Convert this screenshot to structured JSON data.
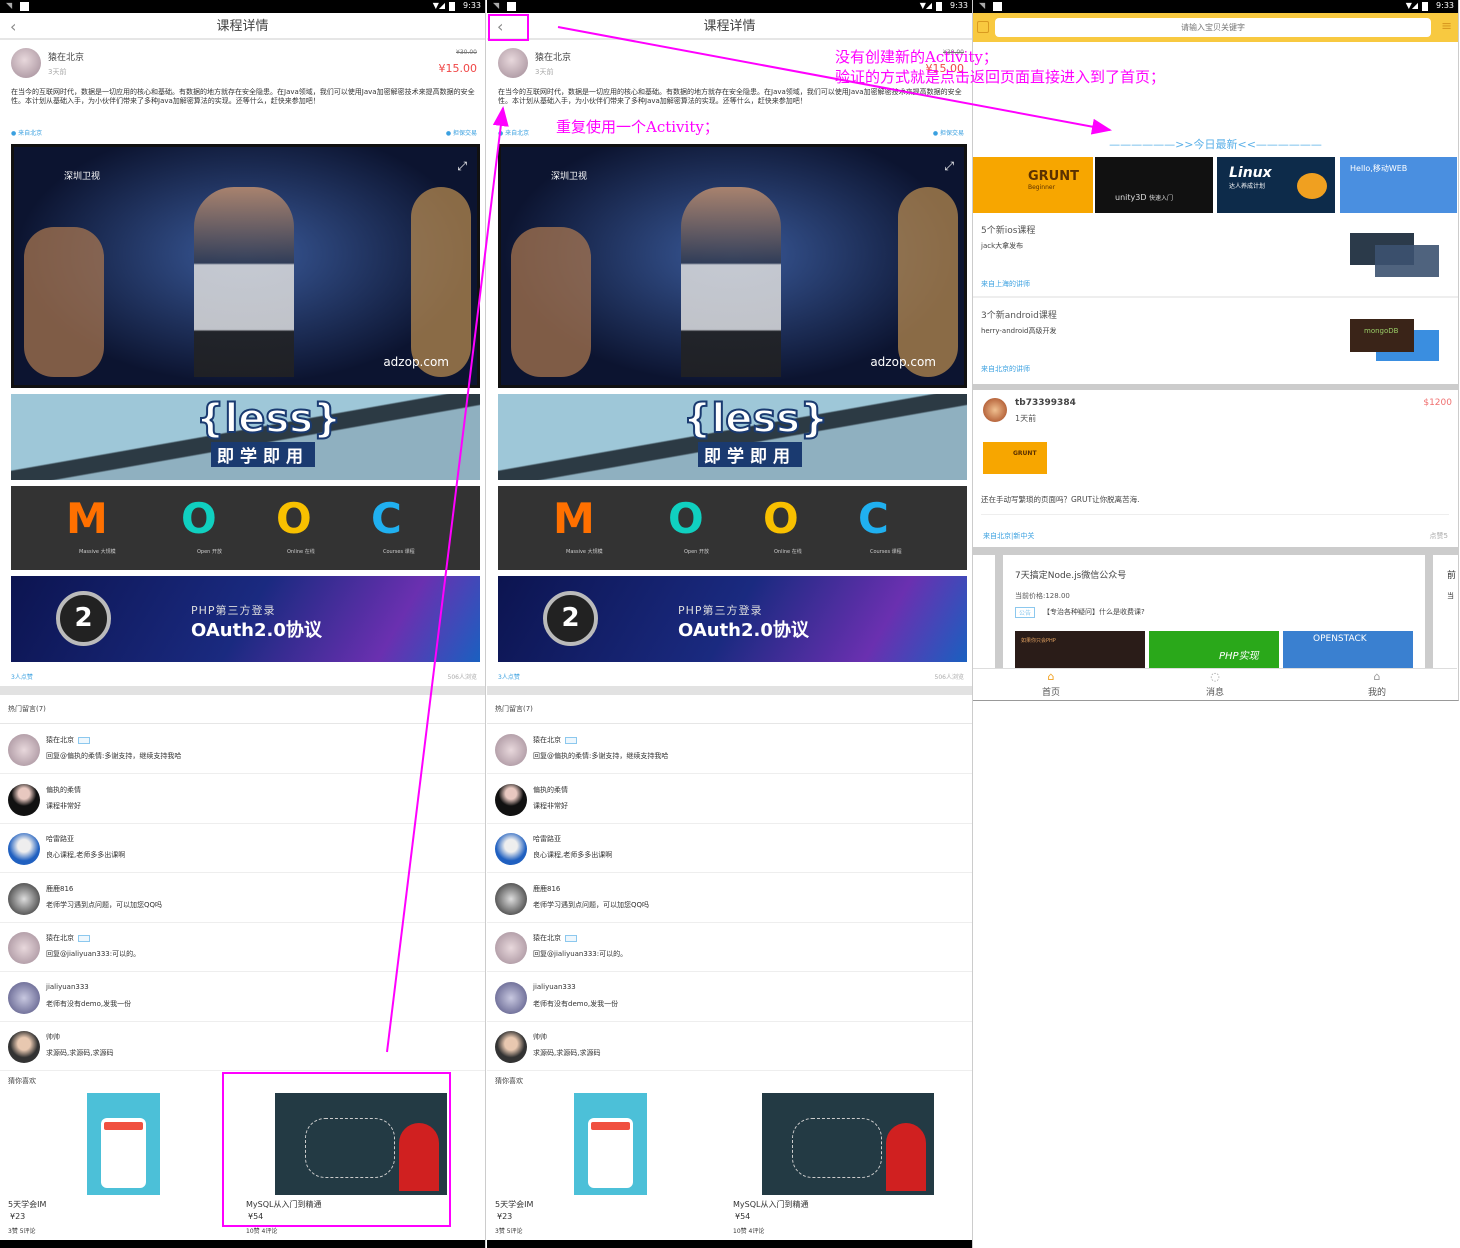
{
  "status_bar": {
    "time": "9:33"
  },
  "detail": {
    "title": "课程详情",
    "back_icon": "chevron-left-icon",
    "author": "猿在北京",
    "posted": "3天前",
    "original_price": "¥30.00",
    "price": "¥15.00",
    "description": "在当今的互联网时代，数据是一切应用的核心和基础。有数据的地方就存在安全隐患。在Java领域，我们可以使用Java加密解密技术来提高数据的安全性。本计划从基础入手，为小伙伴们带来了多种Java加解密算法的实现。还等什么，赶快来参加吧！",
    "location": "来自北京",
    "guarantee": "担保交易",
    "images": {
      "video_channel": "深圳卫视",
      "video_watermark": "adzop.com",
      "less_title": "{less}",
      "less_sub": "即学即用",
      "mooc_letters": [
        "M",
        "O",
        "O",
        "C"
      ],
      "mooc_words": [
        "Massive 大规模",
        "Open 开放",
        "Online 在线",
        "Courses 课程"
      ],
      "oauth_badge": "2",
      "oauth_sub": "PHP第三方登录",
      "oauth_title": "OAuth2.0协议"
    },
    "likes": "3人点赞",
    "views": "506人浏览",
    "comments_header": "热门留言(7)",
    "comments": [
      {
        "name": "猿在北京",
        "text": "回复@偏执的柔情:多谢支持，继续支持我哈",
        "badge": true
      },
      {
        "name": "偏执的柔情",
        "text": "课程非常好",
        "badge": false
      },
      {
        "name": "哈雷路亚",
        "text": "良心课程,老师多多出课啊",
        "badge": false
      },
      {
        "name": "鹿鹿816",
        "text": "老师学习遇到点问题，可以加您QQ吗",
        "badge": false
      },
      {
        "name": "猿在北京",
        "text": "回复@jialiyuan333:可以的。",
        "badge": true
      },
      {
        "name": "jialiyuan333",
        "text": "老师有没有demo,发我一份",
        "badge": false
      },
      {
        "name": "帅帅",
        "text": "求源码,求源码,求源码",
        "badge": false
      }
    ],
    "recommend_header": "猜你喜欢",
    "recommend": [
      {
        "title": "5天学会IM",
        "price": "¥23",
        "stats": "3赞  5评论"
      },
      {
        "title": "MySQL从入门到精通",
        "price": "¥54",
        "stats": "10赞  4评论"
      }
    ]
  },
  "home": {
    "search_placeholder": "请输入宝贝关键字",
    "section_title": "——————>>今日最新<<——————",
    "banners": [
      {
        "title": "GRUNT",
        "sub": "Beginner"
      },
      {
        "title": "unity3D",
        "sub": "快速入门"
      },
      {
        "title": "Linux",
        "sub": "达人养成计划"
      },
      {
        "title": "Hello,移动WEB",
        "sub": ""
      }
    ],
    "list": [
      {
        "title": "5个新ios课程",
        "sub": "jack大拿发布",
        "from": "来自上海的讲师"
      },
      {
        "title": "3个新android课程",
        "sub": "herry-android高级开发",
        "from": "来自北京的讲师",
        "thumb": "mongoDB"
      }
    ],
    "post": {
      "user": "tb73399384",
      "time": "1天前",
      "price": "$1200",
      "thumb": "GRUNT",
      "text": "还在手动写繁琐的页面吗？GRUT让你脱离苦海.",
      "from": "来自北京|新中关",
      "likes": "点赞5"
    },
    "card": {
      "title": "7天搞定Node.js微信公众号",
      "price": "当前价格:128.00",
      "tag": "公告",
      "question": "【专治各种疑问】什么是收费课?",
      "thumbs": [
        "如果你只会PHP",
        "PHP实现",
        "OPENSTACK"
      ],
      "next_title": "前",
      "next_price": "当"
    },
    "tabs": [
      {
        "label": "首页",
        "icon": "home-icon"
      },
      {
        "label": "消息",
        "icon": "message-icon"
      },
      {
        "label": "我的",
        "icon": "profile-icon"
      }
    ]
  },
  "annotations": {
    "note_reuse": "重复使用一个Activity；",
    "note_no_new_line1": "没有创建新的Activity；",
    "note_no_new_line2": "验证的方式就是点击返回页面直接进入到了首页；"
  },
  "colors": {
    "accent_blue": "#3aa0e0",
    "price_red": "#f04646",
    "annotation": "#ff00ff",
    "home_yellow": "#f8c940"
  }
}
